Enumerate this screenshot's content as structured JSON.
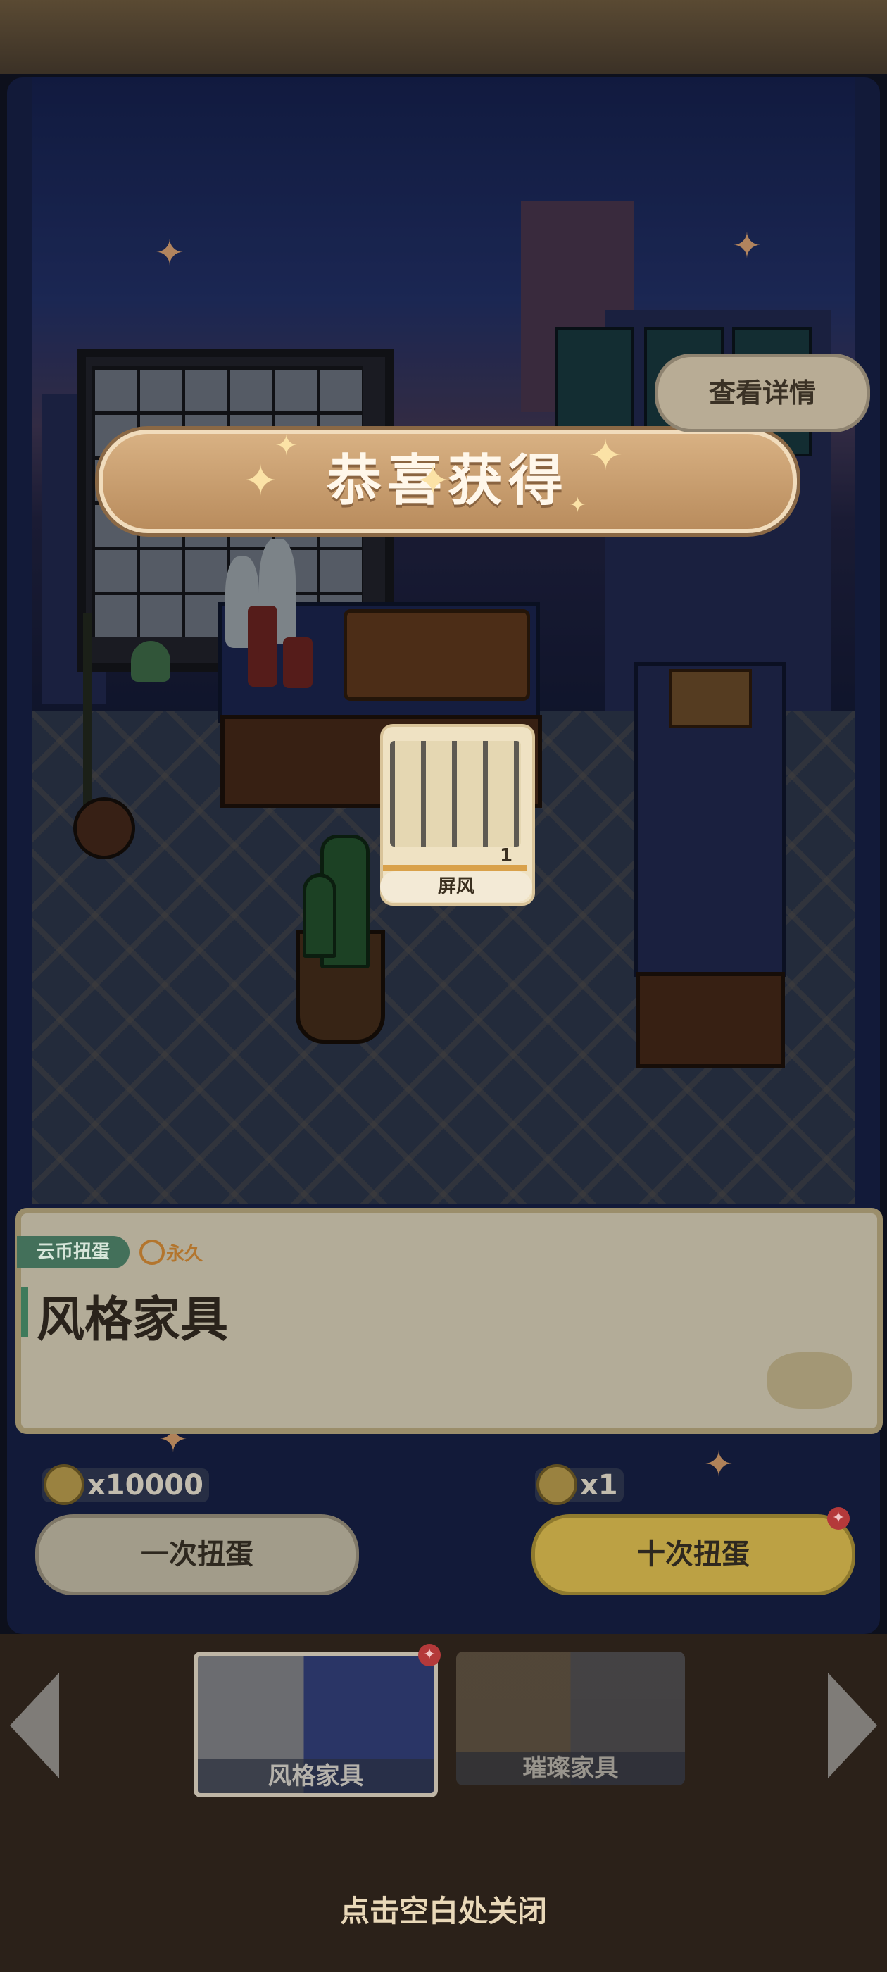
{
  "banner": {
    "title": "恭喜获得"
  },
  "detail_button": {
    "label": "查看详情"
  },
  "reward": {
    "name": "屏风",
    "count": "1"
  },
  "info_card": {
    "tag": "云币扭蛋",
    "duration": "永久",
    "title": "风格家具"
  },
  "draw_once": {
    "cost": "x10000",
    "label": "一次扭蛋"
  },
  "draw_ten": {
    "cost": "x1",
    "label": "十次扭蛋"
  },
  "pools": [
    {
      "label": "风格家具",
      "selected": true
    },
    {
      "label": "璀璨家具",
      "selected": false
    }
  ],
  "close_hint": "点击空白处关闭",
  "colors": {
    "banner": "#c9a06e",
    "tag": "#43705a",
    "ten_button": "#bca144"
  },
  "icons": [
    "star-icon",
    "timer-icon",
    "coin-icon",
    "egg-icon",
    "left-arrow-icon",
    "right-arrow-icon"
  ]
}
